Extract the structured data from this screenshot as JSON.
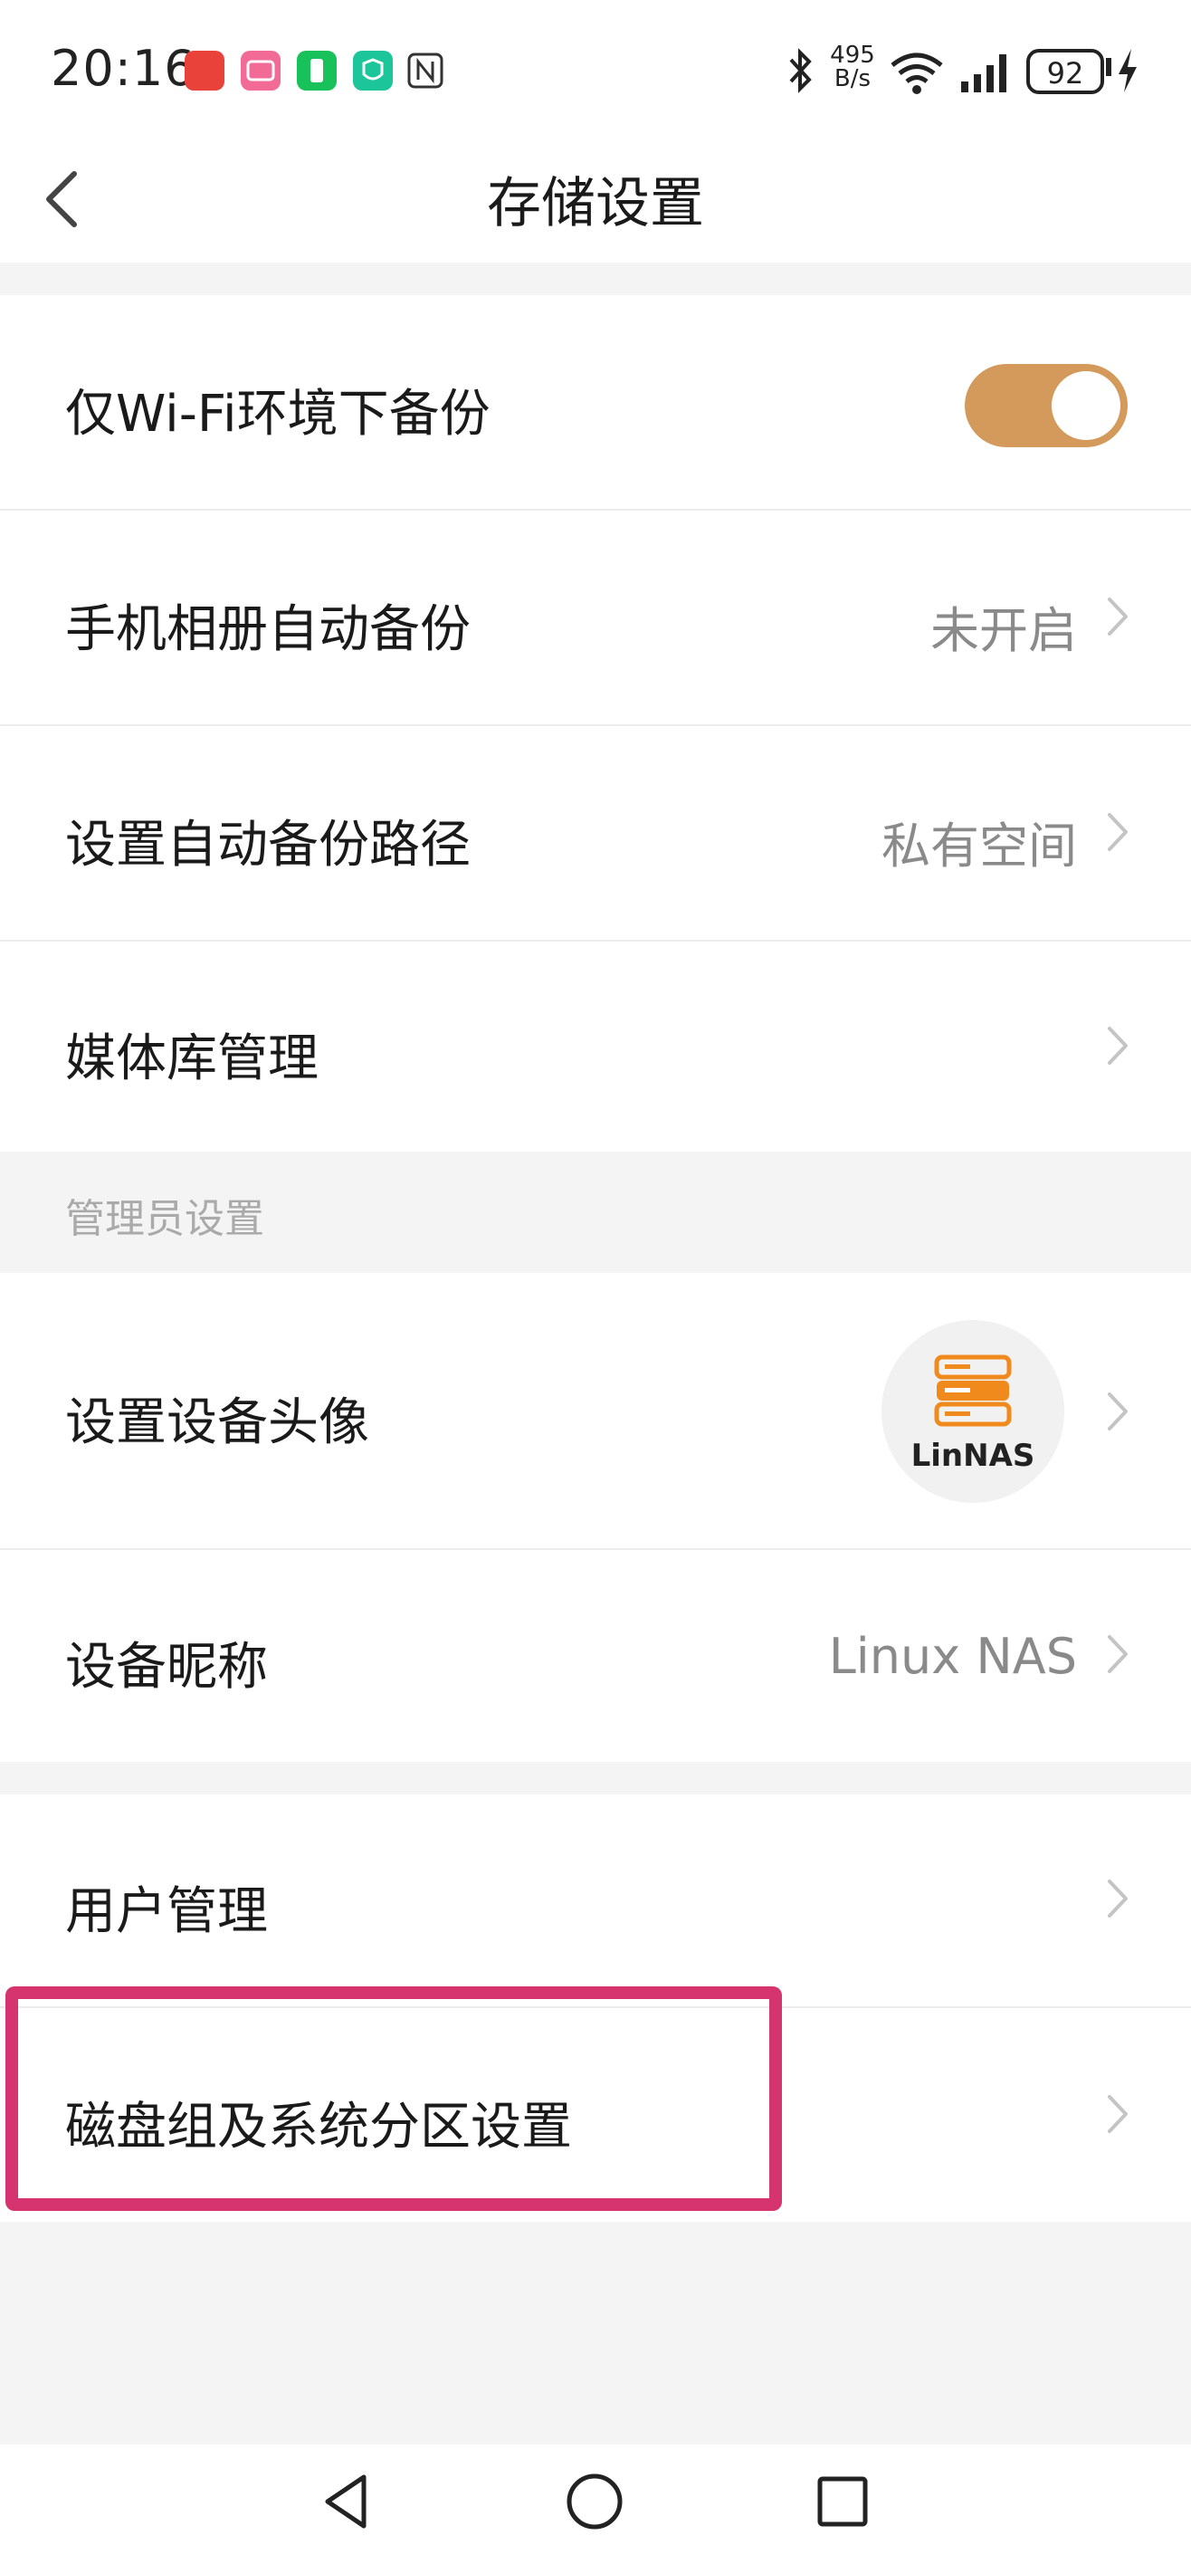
{
  "status_bar": {
    "time": "20:16",
    "net_speed_value": "495",
    "net_speed_unit": "B/s",
    "battery": "92",
    "icons": [
      "app-icon-red-cartoon",
      "bilibili-icon",
      "green-app-icon",
      "mi-home-icon",
      "nfc-icon",
      "bluetooth-icon",
      "wifi-icon",
      "signal-icon",
      "battery-icon",
      "charging-icon"
    ]
  },
  "header": {
    "title": "存储设置",
    "back_icon": "chevron-left-icon"
  },
  "groups": {
    "backup": {
      "wifi_only": {
        "label": "仅Wi-Fi环境下备份",
        "toggle_on": true
      },
      "album_backup": {
        "label": "手机相册自动备份",
        "value": "未开启"
      },
      "backup_path": {
        "label": "设置自动备份路径",
        "value": "私有空间"
      },
      "media_library": {
        "label": "媒体库管理"
      }
    },
    "admin": {
      "section_title": "管理员设置",
      "device_avatar": {
        "label": "设置设备头像",
        "avatar_text": "LinNAS"
      },
      "device_nickname": {
        "label": "设备昵称",
        "value": "Linux NAS"
      }
    },
    "system": {
      "user_management": {
        "label": "用户管理"
      },
      "disk_partition": {
        "label": "磁盘组及系统分区设置"
      }
    }
  },
  "colors": {
    "toggle_on": "#d39a5c",
    "highlight": "#d6346f",
    "avatar_orange": "#f08a1c"
  },
  "nav_bar": {
    "icons": [
      "back-triangle-icon",
      "home-circle-icon",
      "recents-square-icon"
    ]
  }
}
